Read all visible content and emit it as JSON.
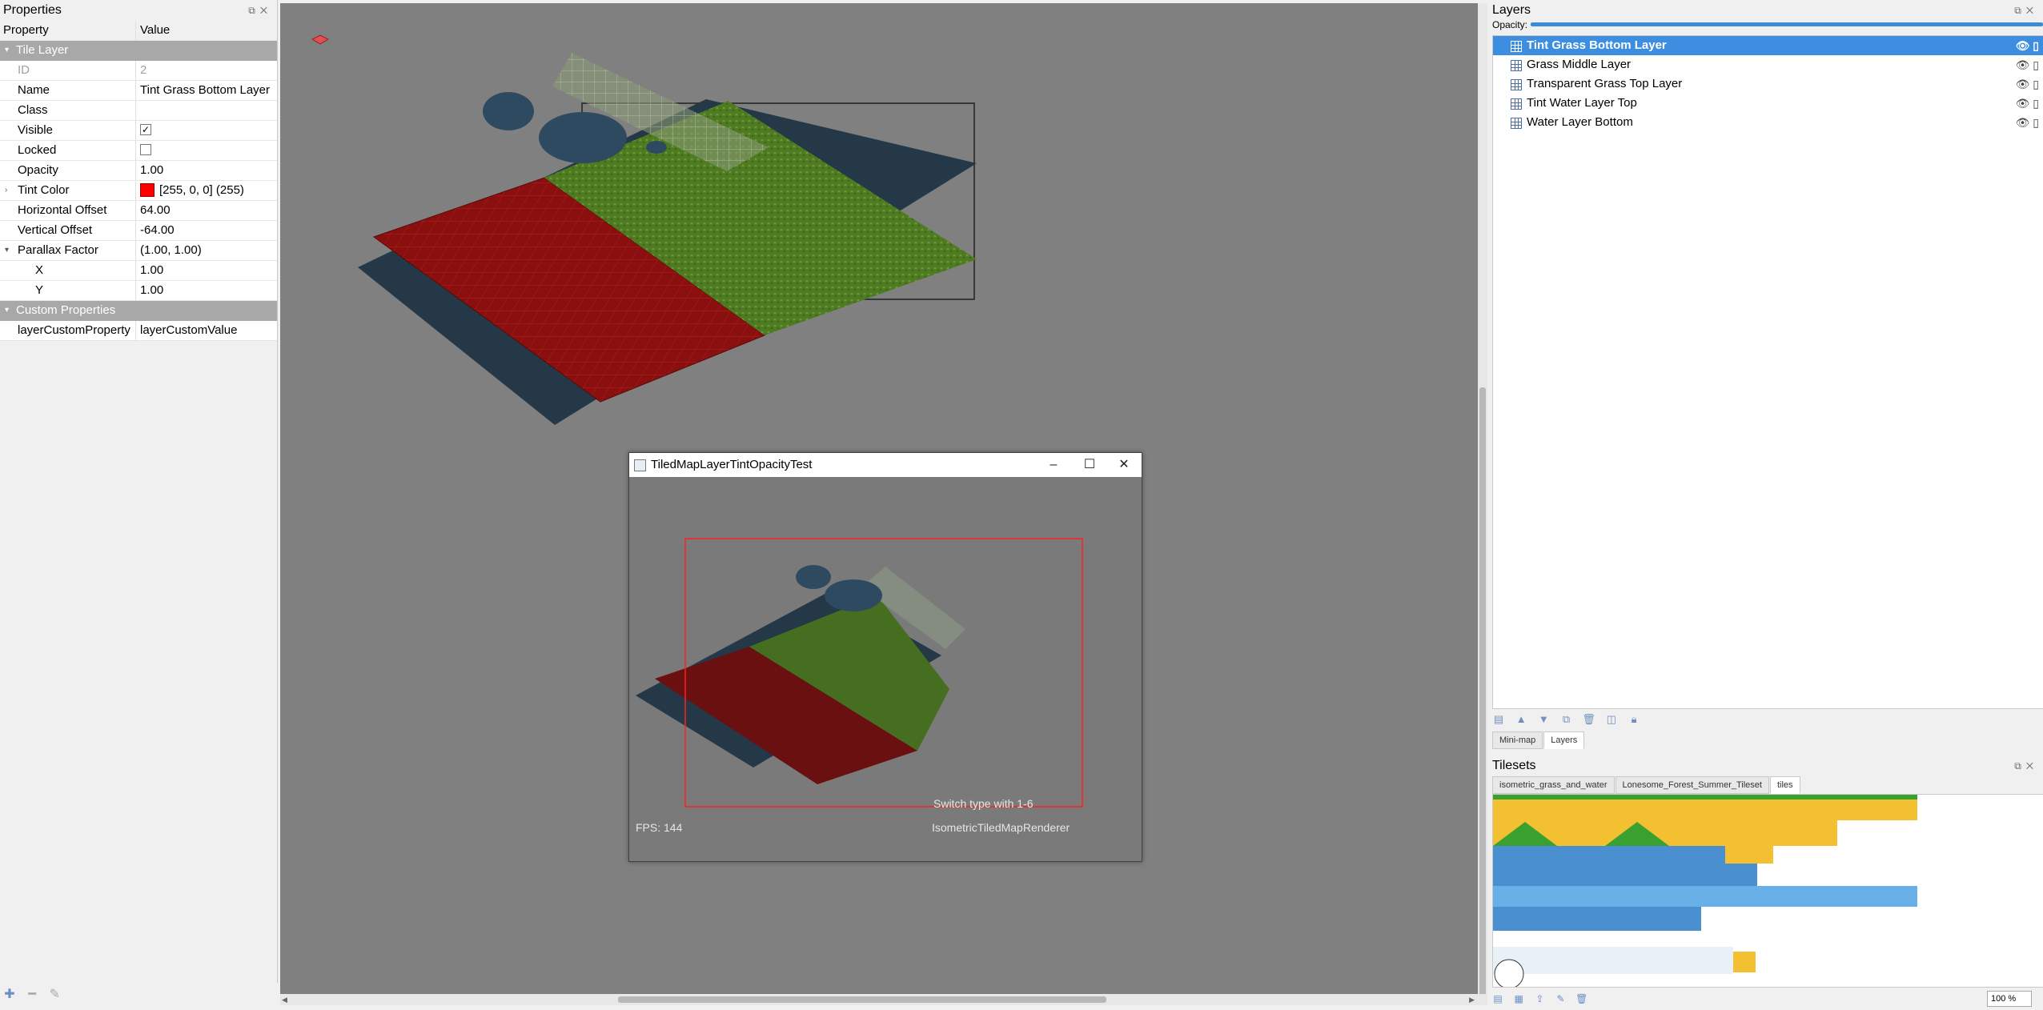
{
  "properties_panel": {
    "title": "Properties",
    "columns": {
      "property": "Property",
      "value": "Value"
    },
    "group_tile_layer": "Tile Layer",
    "rows": {
      "id": {
        "key": "ID",
        "value": "2"
      },
      "name": {
        "key": "Name",
        "value": "Tint Grass Bottom Layer"
      },
      "class": {
        "key": "Class",
        "value": ""
      },
      "visible": {
        "key": "Visible",
        "value": "✓"
      },
      "locked": {
        "key": "Locked",
        "value": ""
      },
      "opacity": {
        "key": "Opacity",
        "value": "1.00"
      },
      "tint_color": {
        "key": "Tint Color",
        "value": "[255, 0, 0] (255)",
        "color": "#ff0000"
      },
      "horizontal_offset": {
        "key": "Horizontal Offset",
        "value": "64.00"
      },
      "vertical_offset": {
        "key": "Vertical Offset",
        "value": "-64.00"
      },
      "parallax_factor": {
        "key": "Parallax Factor",
        "value": "(1.00, 1.00)"
      },
      "parallax_x": {
        "key": "X",
        "value": "1.00"
      },
      "parallax_y": {
        "key": "Y",
        "value": "1.00"
      }
    },
    "group_custom": "Custom Properties",
    "custom_rows": [
      {
        "key": "layerCustomProperty",
        "value": "layerCustomValue"
      }
    ]
  },
  "game_window": {
    "title": "TiledMapLayerTintOpacityTest",
    "fps_label": "FPS: 144",
    "hint_text": "Switch type with 1-6",
    "renderer_text": "IsometricTiledMapRenderer"
  },
  "layers_panel": {
    "title": "Layers",
    "opacity_label": "Opacity:",
    "opacity_value": 1.0,
    "layers": [
      {
        "name": "Tint Grass Bottom Layer",
        "selected": true
      },
      {
        "name": "Grass Middle Layer",
        "selected": false
      },
      {
        "name": "Transparent Grass Top Layer",
        "selected": false
      },
      {
        "name": "Tint Water Layer Top",
        "selected": false
      },
      {
        "name": "Water Layer Bottom",
        "selected": false
      }
    ],
    "tabs": [
      "Mini-map",
      "Layers"
    ]
  },
  "tilesets_panel": {
    "title": "Tilesets",
    "tabs": [
      "isometric_grass_and_water",
      "Lonesome_Forest_Summer_Tileset",
      "tiles"
    ],
    "zoom": "100 %"
  },
  "colors": {
    "accent": "#3d8ee0",
    "canvas": "#808080",
    "tint": "#ff0000"
  }
}
